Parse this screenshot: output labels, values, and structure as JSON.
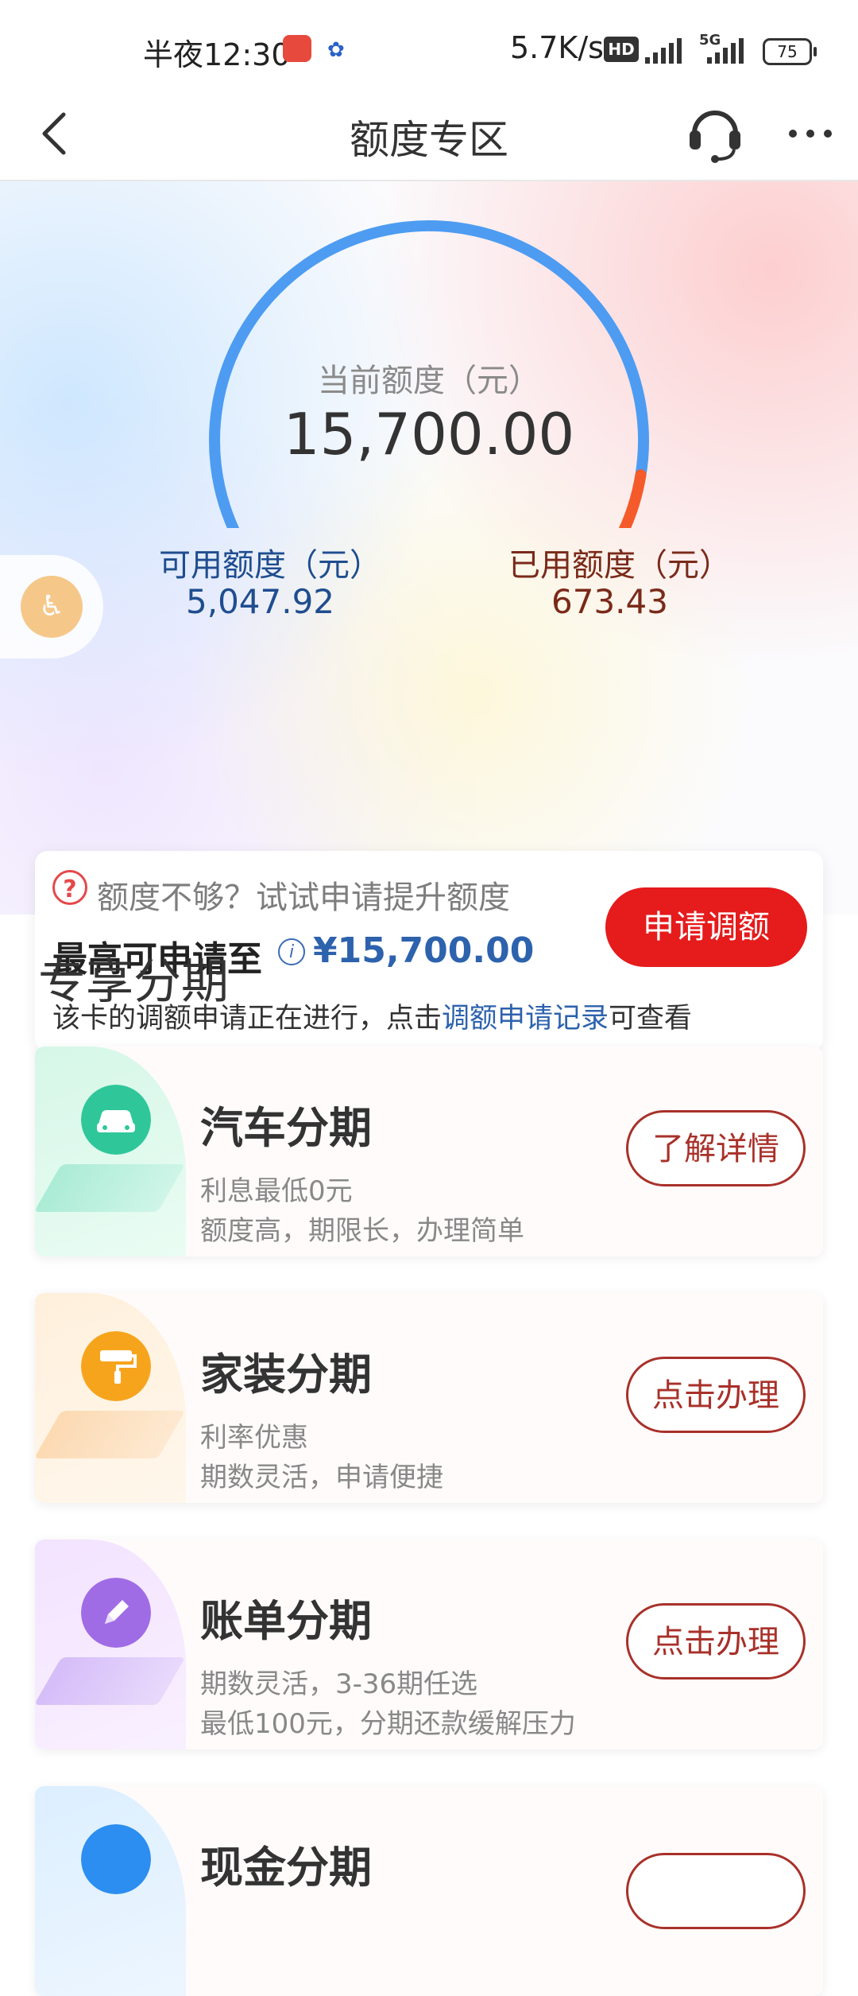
{
  "status_bar": {
    "time": "半夜12:30",
    "net_speed": "5.7K/s",
    "hd_badge": "HD",
    "signal_label": "5G",
    "battery": "75"
  },
  "nav": {
    "title": "额度专区"
  },
  "credit": {
    "current_label": "当前额度（元）",
    "current_value": "15,700.00",
    "available_label": "可用额度（元）",
    "available_value": "5,047.92",
    "used_label": "已用额度（元）",
    "used_value": "673.43"
  },
  "limit_card": {
    "hint": "额度不够？试试申请提升额度",
    "max_label": "最高可申请至",
    "max_amount": "¥15,700.00",
    "status_prefix": "该卡的调额申请正在进行，点击",
    "status_link": "调额申请记录",
    "status_suffix": "可查看",
    "apply_button": "申请调额"
  },
  "section": {
    "title": "专享分期"
  },
  "cards": [
    {
      "title": "汽车分期",
      "sub1": "利息最低0元",
      "sub2": "额度高，期限长，办理简单",
      "button": "了解详情"
    },
    {
      "title": "家装分期",
      "sub1": "利率优惠",
      "sub2": "期数灵活，申请便捷",
      "button": "点击办理"
    },
    {
      "title": "账单分期",
      "sub1": "期数灵活，3-36期任选",
      "sub2": "最低100元，分期还款缓解压力",
      "button": "点击办理"
    },
    {
      "title": "现金分期",
      "sub1": "",
      "sub2": "",
      "button": ""
    }
  ],
  "colors": {
    "accent_red": "#e51b1c",
    "link_blue": "#2d62ad",
    "gauge_blue": "#4d9cf2",
    "gauge_orange": "#f55a2a"
  },
  "gauge": {
    "used_fraction": 0.043
  }
}
